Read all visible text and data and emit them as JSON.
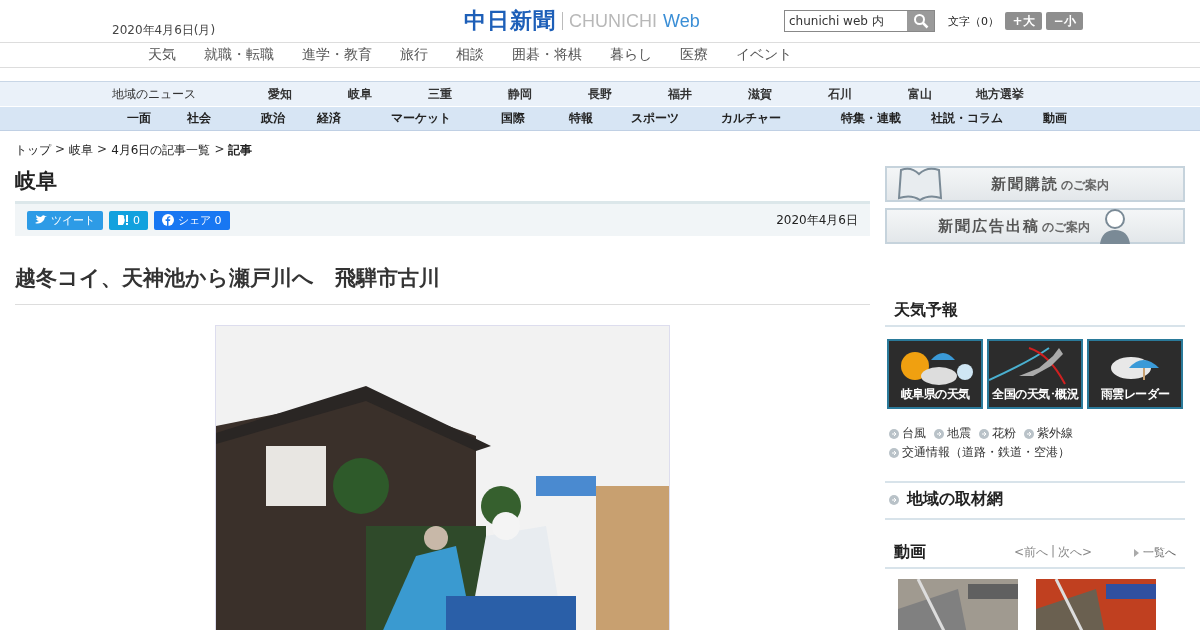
{
  "header": {
    "date": "2020年4月6日(月)",
    "logo": {
      "name": "中日新聞",
      "latin": "CHUNICHI",
      "web": "Web"
    },
    "search": {
      "value": "chunichi web 内"
    },
    "font_size": {
      "label": "文字（0）",
      "buttons": [
        "+大",
        "−小"
      ]
    }
  },
  "nav": [
    "天気",
    "就職・転職",
    "進学・教育",
    "旅行",
    "相談",
    "囲碁・将棋",
    "暮らし",
    "医療",
    "イベント"
  ],
  "region_bar": {
    "label": "地域のニュース",
    "items": [
      "愛知",
      "岐阜",
      "三重",
      "静岡",
      "長野",
      "福井",
      "滋賀",
      "石川",
      "富山",
      "地方選挙"
    ]
  },
  "category_bar": [
    "一面",
    "社会",
    "政治",
    "経済",
    "マーケット",
    "国際",
    "特報",
    "スポーツ",
    "カルチャー",
    "特集・連載",
    "社説・コラム",
    "動画"
  ],
  "breadcrumb": {
    "separator": ">",
    "items": [
      {
        "label": "トップ",
        "current": false
      },
      {
        "label": "岐阜",
        "current": false
      },
      {
        "label": "4月6日の記事一覧",
        "current": false
      },
      {
        "label": "記事",
        "current": true
      }
    ]
  },
  "section_title": "岐阜",
  "share": {
    "buttons": [
      {
        "kind": "twitter",
        "label": "ツイート"
      },
      {
        "kind": "hatena",
        "label": "0"
      },
      {
        "kind": "facebook",
        "label": "シェア 0"
      }
    ],
    "date": "2020年4月6日"
  },
  "article": {
    "title": "越冬コイ、天神池から瀬戸川へ　飛騨市古川"
  },
  "sidebar": {
    "banners": [
      {
        "kind": "book",
        "title": "新聞購読",
        "suffix": "のご案内"
      },
      {
        "kind": "person",
        "title": "新聞広告出稿",
        "suffix": "のご案内"
      }
    ],
    "weather": {
      "title": "天気予報",
      "tiles": [
        {
          "kind": "sun",
          "label": "岐阜県の天気"
        },
        {
          "label": "全国の天気･概況"
        },
        {
          "kind": "cloud",
          "label": "雨雲レーダー"
        }
      ],
      "links": [
        "台風",
        "地震",
        "花粉",
        "紫外線",
        "交通情報（道路・鉄道・空港）"
      ]
    },
    "network": "地域の取材網",
    "video": {
      "title": "動画",
      "prev": "<前へ",
      "divider": "|",
      "next": "次へ>",
      "list": "一覧へ"
    }
  }
}
